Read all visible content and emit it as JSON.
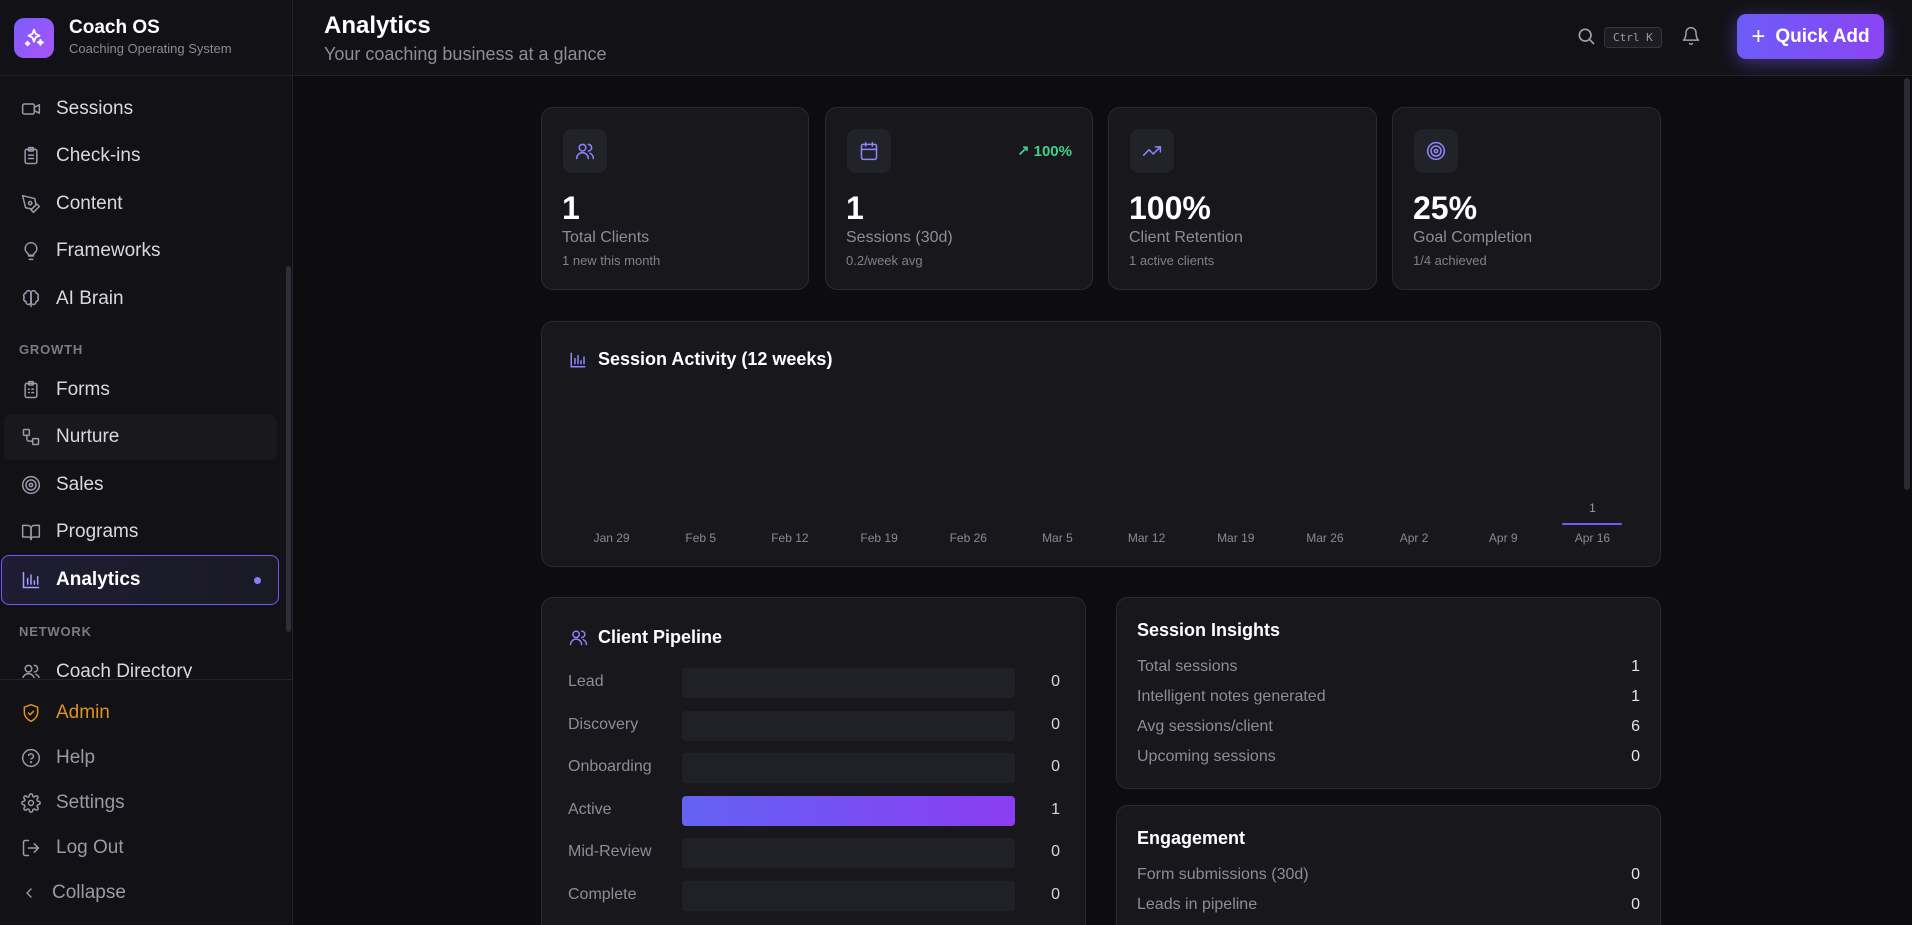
{
  "brand": {
    "name": "Coach OS",
    "tagline": "Coaching Operating System"
  },
  "nav": {
    "items_top": [
      {
        "label": "Sessions",
        "icon": "video-icon"
      },
      {
        "label": "Check-ins",
        "icon": "clipboard-icon"
      },
      {
        "label": "Content",
        "icon": "pen-tool-icon"
      },
      {
        "label": "Frameworks",
        "icon": "lightbulb-icon"
      },
      {
        "label": "AI Brain",
        "icon": "brain-icon"
      }
    ],
    "growth_label": "GROWTH",
    "items_growth": [
      {
        "label": "Forms",
        "icon": "clipboard-list-icon"
      },
      {
        "label": "Nurture",
        "icon": "workflow-icon"
      },
      {
        "label": "Sales",
        "icon": "target-icon"
      },
      {
        "label": "Programs",
        "icon": "book-open-icon"
      },
      {
        "label": "Analytics",
        "icon": "bar-chart-icon"
      }
    ],
    "network_label": "NETWORK",
    "items_network": [
      {
        "label": "Coach Directory",
        "icon": "users-icon"
      }
    ],
    "bottom": {
      "admin": "Admin",
      "help": "Help",
      "settings": "Settings",
      "logout": "Log Out",
      "collapse": "Collapse"
    }
  },
  "header": {
    "title": "Analytics",
    "subtitle": "Your coaching business at a glance",
    "shortcut": "Ctrl K",
    "quick_add": "Quick Add"
  },
  "stats": [
    {
      "value": "1",
      "label": "Total Clients",
      "sub": "1 new this month",
      "icon": "users-icon",
      "trend": ""
    },
    {
      "value": "1",
      "label": "Sessions (30d)",
      "sub": "0.2/week avg",
      "icon": "calendar-icon",
      "trend": "100%"
    },
    {
      "value": "100%",
      "label": "Client Retention",
      "sub": "1 active clients",
      "icon": "trending-up-icon",
      "trend": ""
    },
    {
      "value": "25%",
      "label": "Goal Completion",
      "sub": "1/4 achieved",
      "icon": "target-icon",
      "trend": ""
    }
  ],
  "activity": {
    "title": "Session Activity (12 weeks)"
  },
  "chart_data": {
    "type": "bar",
    "title": "Session Activity (12 weeks)",
    "categories": [
      "Jan 29",
      "Feb 5",
      "Feb 12",
      "Feb 19",
      "Feb 26",
      "Mar 5",
      "Mar 12",
      "Mar 19",
      "Mar 26",
      "Apr 2",
      "Apr 9",
      "Apr 16"
    ],
    "values": [
      0,
      0,
      0,
      0,
      0,
      0,
      0,
      0,
      0,
      0,
      0,
      1
    ],
    "value_labels": [
      "",
      "",
      "",
      "",
      "",
      "",
      "",
      "",
      "",
      "",
      "",
      "1"
    ]
  },
  "pipeline": {
    "title": "Client Pipeline",
    "max": 1,
    "stages": [
      {
        "label": "Lead",
        "count": 0
      },
      {
        "label": "Discovery",
        "count": 0
      },
      {
        "label": "Onboarding",
        "count": 0
      },
      {
        "label": "Active",
        "count": 1
      },
      {
        "label": "Mid-Review",
        "count": 0
      },
      {
        "label": "Complete",
        "count": 0
      }
    ]
  },
  "insights": {
    "title": "Session Insights",
    "rows": [
      {
        "k": "Total sessions",
        "v": "1"
      },
      {
        "k": "Intelligent notes generated",
        "v": "1"
      },
      {
        "k": "Avg sessions/client",
        "v": "6"
      },
      {
        "k": "Upcoming sessions",
        "v": "0"
      }
    ]
  },
  "engagement": {
    "title": "Engagement",
    "rows": [
      {
        "k": "Form submissions (30d)",
        "v": "0"
      },
      {
        "k": "Leads in pipeline",
        "v": "0"
      }
    ]
  },
  "colors": {
    "accent": "#7c5cff",
    "admin": "#e0901f",
    "trend_up": "#3fd18c"
  }
}
